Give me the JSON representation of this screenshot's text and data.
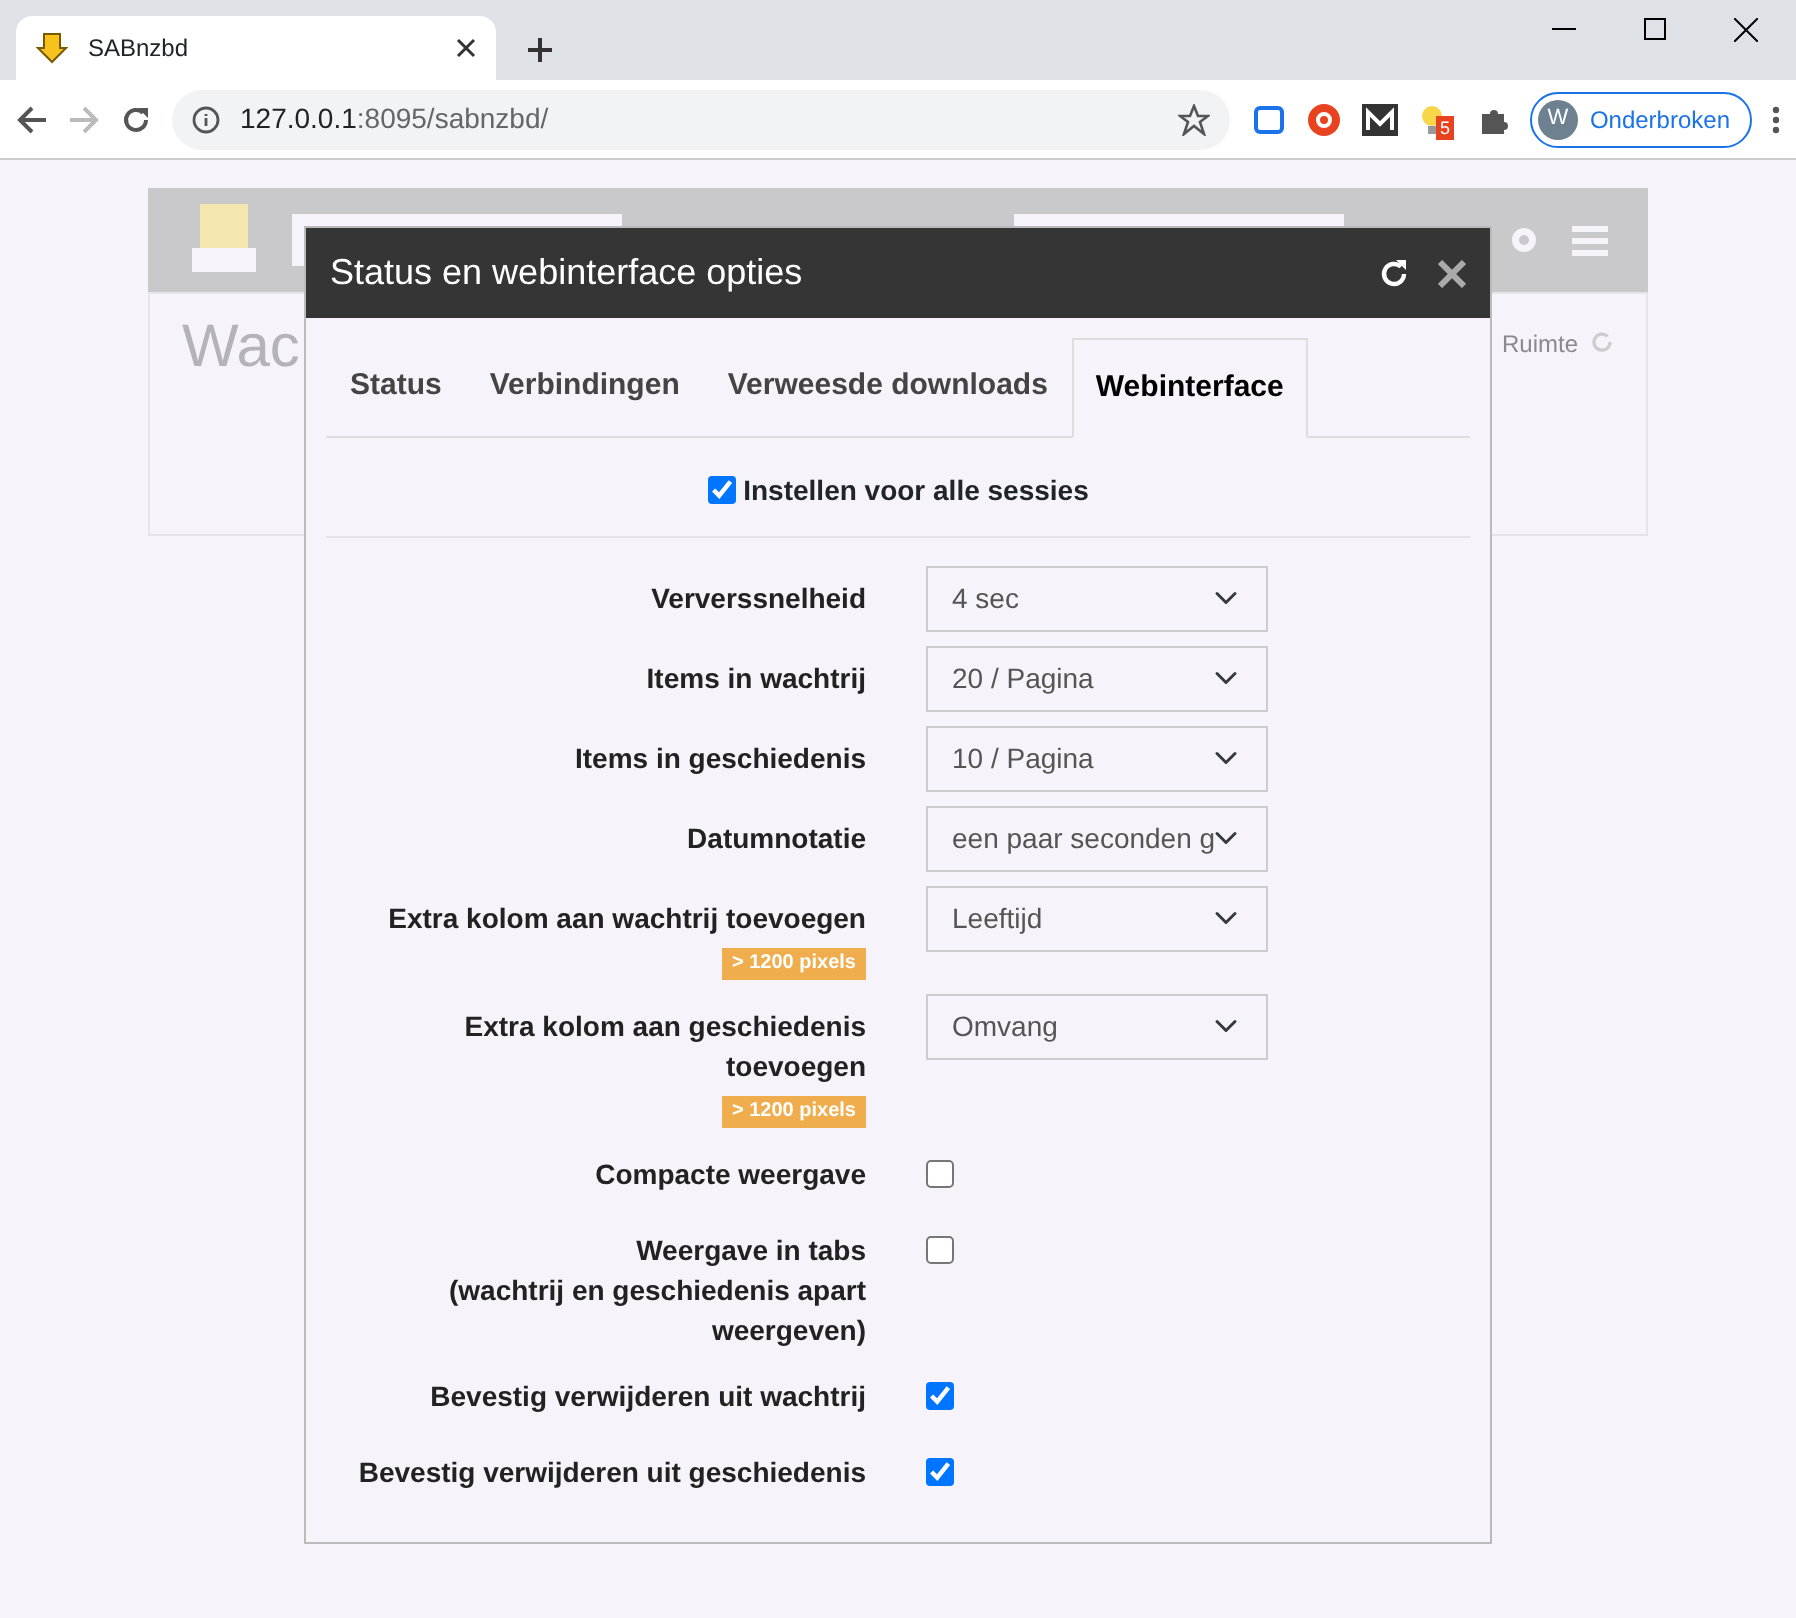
{
  "browser": {
    "tab_title": "SABnzbd",
    "address_host": "127.0.0.1",
    "address_path": ":8095/sabnzbd/",
    "extension_badge": "5",
    "profile_initial": "W",
    "profile_name": "Onderbroken"
  },
  "background_app": {
    "heading": "Wac",
    "space_label": "Ruimte"
  },
  "modal": {
    "title": "Status en webinterface opties",
    "tabs": [
      {
        "label": "Status",
        "selected": false
      },
      {
        "label": "Verbindingen",
        "selected": false
      },
      {
        "label": "Verweesde downloads",
        "selected": false
      },
      {
        "label": "Webinterface",
        "selected": true
      }
    ],
    "session_option": {
      "label": "Instellen voor alle sessies",
      "checked": true
    },
    "settings": [
      {
        "kind": "select",
        "label": "Ververssnelheid",
        "value": "4 sec"
      },
      {
        "kind": "select",
        "label": "Items in wachtrij",
        "value": "20 / Pagina"
      },
      {
        "kind": "select",
        "label": "Items in geschiedenis",
        "value": "10 / Pagina"
      },
      {
        "kind": "select",
        "label": "Datumnotatie",
        "value": "een paar seconden g"
      },
      {
        "kind": "select",
        "label": "Extra kolom aan wachtrij toevoegen",
        "badge": "> 1200 pixels",
        "value": "Leeftijd"
      },
      {
        "kind": "select",
        "label": "Extra kolom aan geschiedenis toevoegen",
        "badge": "> 1200 pixels",
        "value": "Omvang"
      },
      {
        "kind": "checkbox",
        "label": "Compacte weergave",
        "checked": false
      },
      {
        "kind": "checkbox",
        "label": "Weergave in tabs",
        "note": "(wachtrij en geschiedenis apart weergeven)",
        "checked": false
      },
      {
        "kind": "checkbox",
        "label": "Bevestig verwijderen uit wachtrij",
        "checked": true
      },
      {
        "kind": "checkbox",
        "label": "Bevestig verwijderen uit geschiedenis",
        "checked": true
      }
    ]
  }
}
